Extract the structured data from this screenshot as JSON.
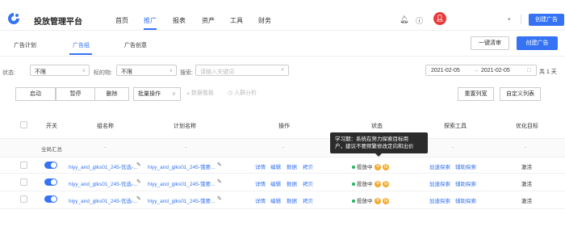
{
  "header": {
    "app_title": "投放管理平台",
    "nav": [
      "首页",
      "推广",
      "报表",
      "资产",
      "工具",
      "财务"
    ],
    "create_ad_label": "创建广告"
  },
  "tabs": [
    "广告计划",
    "广告组",
    "广告创意"
  ],
  "tab_actions": {
    "clear_label": "一键清审",
    "create_label": "创建广告"
  },
  "filters": {
    "status_label": "状态:",
    "status_value": "不限",
    "target_label": "标的物:",
    "target_value": "不限",
    "search_label": "搜索:",
    "search_placeholder": "请输入关键词",
    "date_start": "2021-02-05",
    "date_sep": "→",
    "date_end": "2021-02-05",
    "day_count": "共 1 天"
  },
  "actions": {
    "start": "启动",
    "pause": "暂停",
    "delete": "删除",
    "batch": "批量操作",
    "data_report": "数据看板",
    "crowd_analysis": "人群分析",
    "reset_columns": "重置列宽",
    "custom_columns": "自定义列表"
  },
  "table": {
    "headers": [
      "开关",
      "组名称",
      "计划名称",
      "操作",
      "状态",
      "探索工具",
      "优化目标"
    ],
    "summary": {
      "label": "全局汇总",
      "dash": "-"
    },
    "rows": [
      {
        "group_name": "hiyy_and_glks01_245-优选-...",
        "plan_name": "hiyy_and_glks01_245-饿要...",
        "ops": [
          "详情",
          "编辑",
          "数据",
          "拷贝"
        ],
        "status": "投放中",
        "status_tags": [
          "学",
          "探"
        ],
        "explore": [
          "加速探索",
          "辅助探索"
        ],
        "goal": "激活"
      },
      {
        "group_name": "hiyy_and_glks01_245-优选-...",
        "plan_name": "hiyy_and_glks01_245-饿要...",
        "ops": [
          "详情",
          "编辑",
          "数据",
          "拷贝"
        ],
        "status": "投放中",
        "status_tags": [
          "学",
          "探"
        ],
        "explore": [
          "加速探索",
          "辅助探索"
        ],
        "goal": "激活"
      },
      {
        "group_name": "hiyy_and_glks01_245-优选-...",
        "plan_name": "hiyy_and_glks01_245-饿要...",
        "ops": [
          "详情",
          "编辑",
          "数据",
          "拷贝"
        ],
        "status": "投放中",
        "status_tags": [
          "学",
          "探"
        ],
        "explore": [
          "加速探索",
          "辅助探索"
        ],
        "goal": "激活"
      }
    ]
  },
  "tooltip": {
    "line1": "学习期：系统在努力探索目标用",
    "line2": "户，建议不要频繁修改定向和出价"
  },
  "colors": {
    "accent": "#3573f4",
    "status_green": "#22b35e",
    "tag_orange": "#f5a623"
  }
}
